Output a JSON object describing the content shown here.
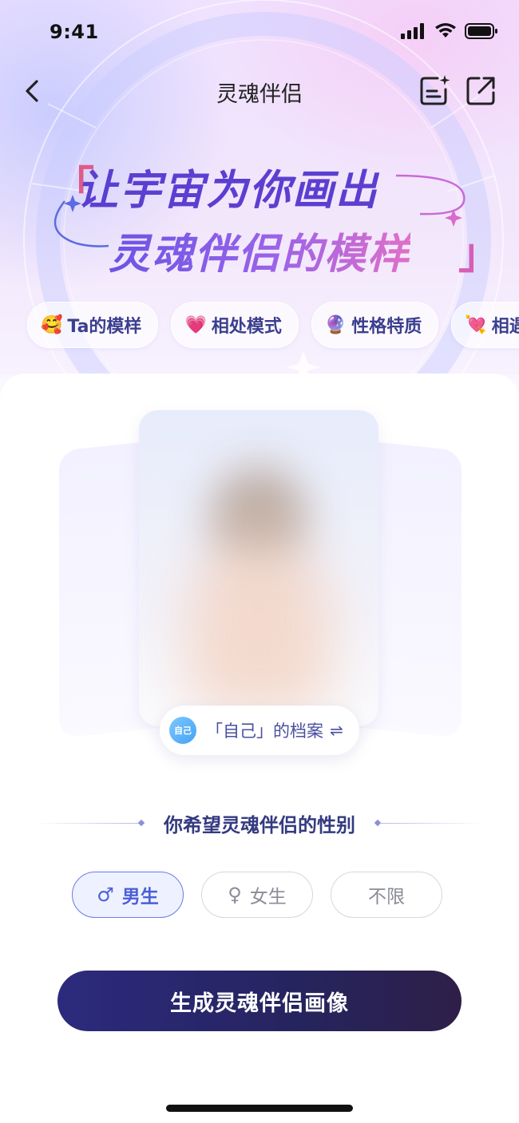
{
  "status_bar": {
    "time": "9:41"
  },
  "nav": {
    "title": "灵魂伴侣"
  },
  "headline": {
    "line1": "让宇宙为你画出",
    "line2": "灵魂伴侣的模样",
    "open_bracket": "「",
    "close_bracket": "」"
  },
  "chips": [
    {
      "emoji": "🥰",
      "label": "Ta的模样"
    },
    {
      "emoji": "💗",
      "label": "相处模式"
    },
    {
      "emoji": "🔮",
      "label": "性格特质"
    },
    {
      "emoji": "💘",
      "label": "相遇"
    }
  ],
  "profile": {
    "avatar_text": "自己",
    "label": "「自己」的档案",
    "swap_icon": "⇌"
  },
  "gender_section": {
    "title": "你希望灵魂伴侣的性别",
    "options": [
      {
        "label": "男生",
        "icon": "♂",
        "selected": true
      },
      {
        "label": "女生",
        "icon": "♀",
        "selected": false
      },
      {
        "label": "不限",
        "icon": "",
        "selected": false
      }
    ]
  },
  "cta": {
    "label": "生成灵魂伴侣画像"
  },
  "colors": {
    "accent": "#4b5fd6",
    "cta_bg": "#26245e",
    "headline": "#5b3fd0"
  }
}
